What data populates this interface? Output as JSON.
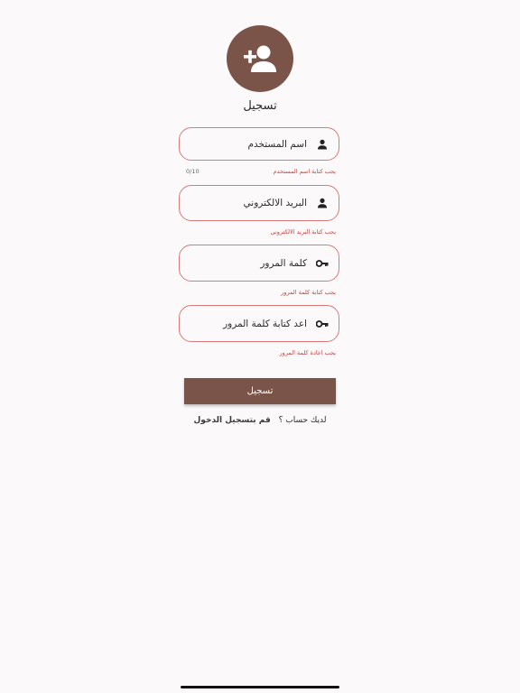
{
  "page": {
    "title": "تسجيل"
  },
  "colors": {
    "primary": "#7a5448",
    "error": "#c9423f",
    "field_border": "#d97a7a",
    "background": "#fbf9fa"
  },
  "form": {
    "username": {
      "value": "اسم المستخدم",
      "error": "يجب كتابة اسم المستخدم",
      "counter": "0/10",
      "icon": "person-icon"
    },
    "email": {
      "value": "البريد الالكتروني",
      "error": "يجب كتابة البريد الالكتروني",
      "icon": "person-icon"
    },
    "password": {
      "value": "كلمة المرور",
      "error": "يجب كتابة كلمة المرور",
      "icon": "key-icon"
    },
    "confirm_password": {
      "value": "اعد كتابة كلمة المرور",
      "error": "يجب اعادة كلمة المرور",
      "icon": "key-icon"
    },
    "submit_label": "تسجيل"
  },
  "login": {
    "prompt": "لديك حساب ؟",
    "link": "قم بتسجيل الدخول"
  },
  "header": {
    "avatar_icon": "person-add-icon"
  }
}
